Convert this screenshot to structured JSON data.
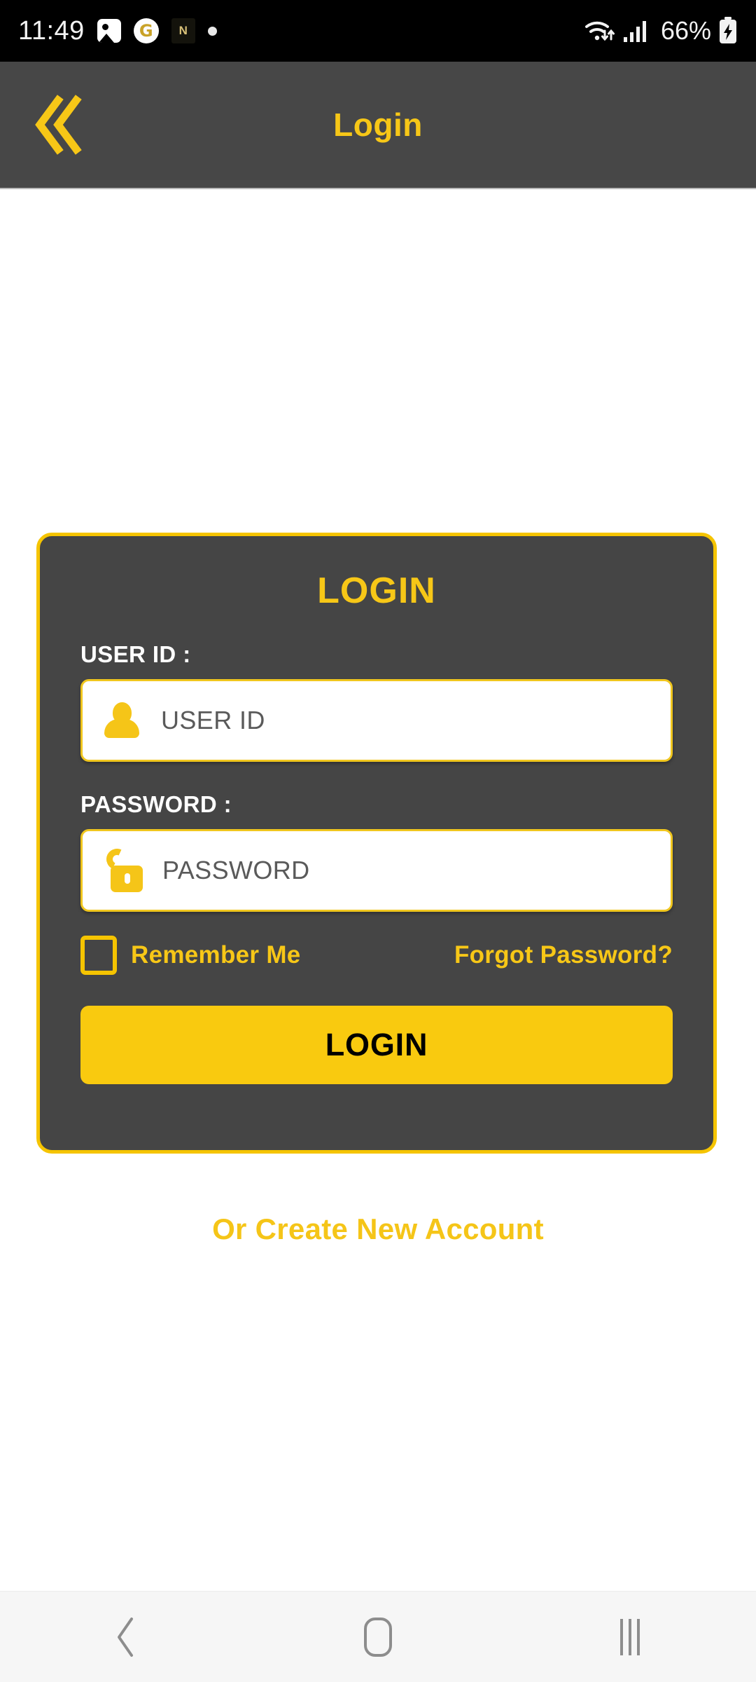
{
  "statusbar": {
    "time": "11:49",
    "battery_percent": "66%",
    "icons": [
      "photo-icon",
      "gold-app-icon",
      "crest-icon",
      "dot-icon",
      "wifi-icon",
      "signal-icon",
      "battery-charging-icon"
    ],
    "gold_app_glyph": "G",
    "crest_glyph": "N"
  },
  "header": {
    "title": "Login",
    "back_icon": "double-chevron-left-icon",
    "background_color": "#474747",
    "accent_color": "#f7c717"
  },
  "card": {
    "title": "LOGIN",
    "border_color": "#f5c400",
    "background_color": "#454545",
    "fields": [
      {
        "label": "USER ID :",
        "placeholder": "USER ID",
        "value": "",
        "icon": "user-icon"
      },
      {
        "label": "PASSWORD :",
        "placeholder": "PASSWORD",
        "value": "",
        "icon": "open-padlock-icon"
      }
    ],
    "remember_me": {
      "label": "Remember Me",
      "checked": false
    },
    "forgot_password": "Forgot Password?",
    "submit_label": "LOGIN"
  },
  "create_account": "Or Create New Account",
  "navbar": {
    "back": "back-chevron-icon",
    "home": "home-icon",
    "recents": "recents-icon"
  }
}
